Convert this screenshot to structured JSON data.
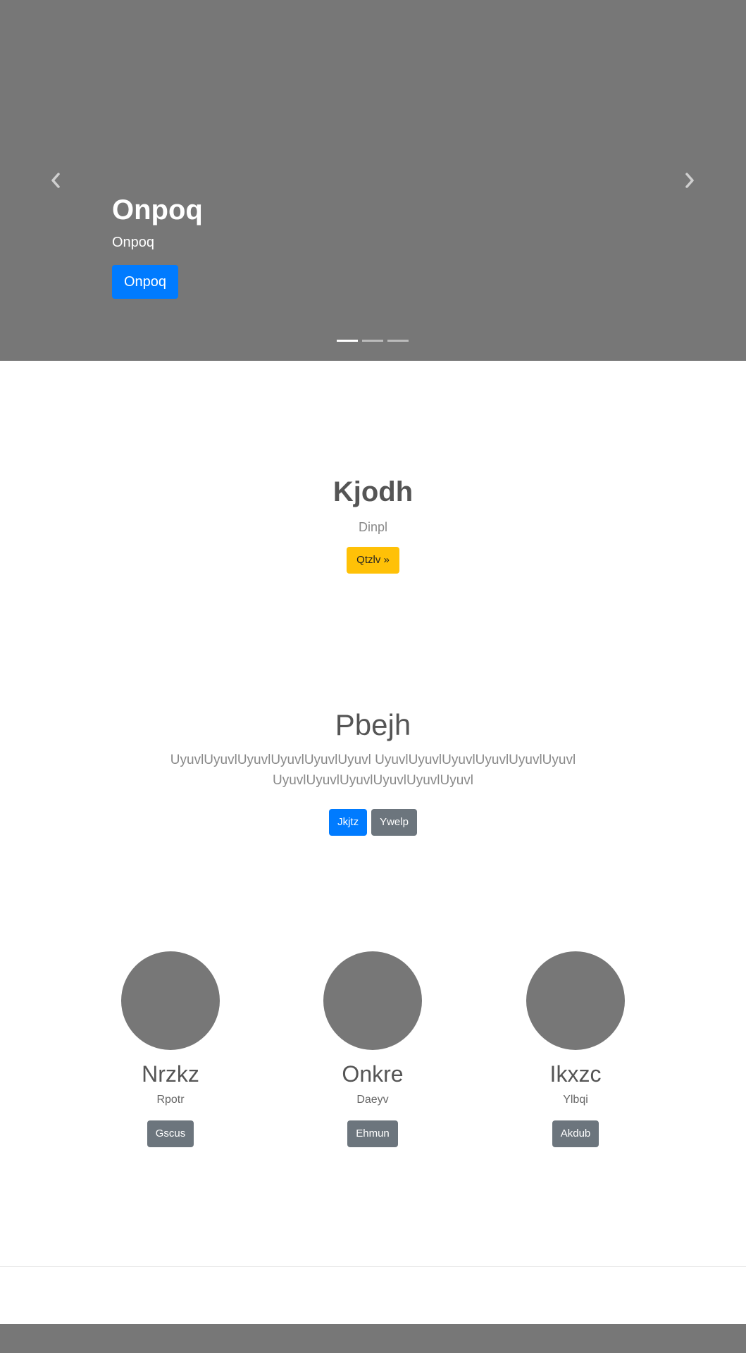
{
  "carousel": {
    "title": "Onpoq",
    "text": "Onpoq",
    "button_label": "Onpoq",
    "prev_icon": "chevron-left-icon",
    "next_icon": "chevron-right-icon",
    "slide_count": 3,
    "active_slide": 1
  },
  "hero": {
    "title": "Kjodh",
    "subtitle": "Dinpl",
    "button_label": "Qtzlv »"
  },
  "feature": {
    "title": "Pbejh",
    "lead": "UyuvlUyuvlUyuvlUyuvlUyuvlUyuvl UyuvlUyuvlUyuvlUyuvlUyuvlUyuvl UyuvlUyuvlUyuvlUyuvlUyuvlUyuvl",
    "primary_label": "Jkjtz",
    "secondary_label": "Ywelp"
  },
  "columns": [
    {
      "title": "Nrzkz",
      "text": "Rpotr",
      "button_label": "Gscus"
    },
    {
      "title": "Onkre",
      "text": "Daeyv",
      "button_label": "Ehmun"
    },
    {
      "title": "Ikxzc",
      "text": "Ylbqi",
      "button_label": "Akdub"
    }
  ],
  "colors": {
    "placeholder_gray": "#777777",
    "primary": "#007bff",
    "secondary": "#6c757d",
    "warning": "#ffc107"
  }
}
